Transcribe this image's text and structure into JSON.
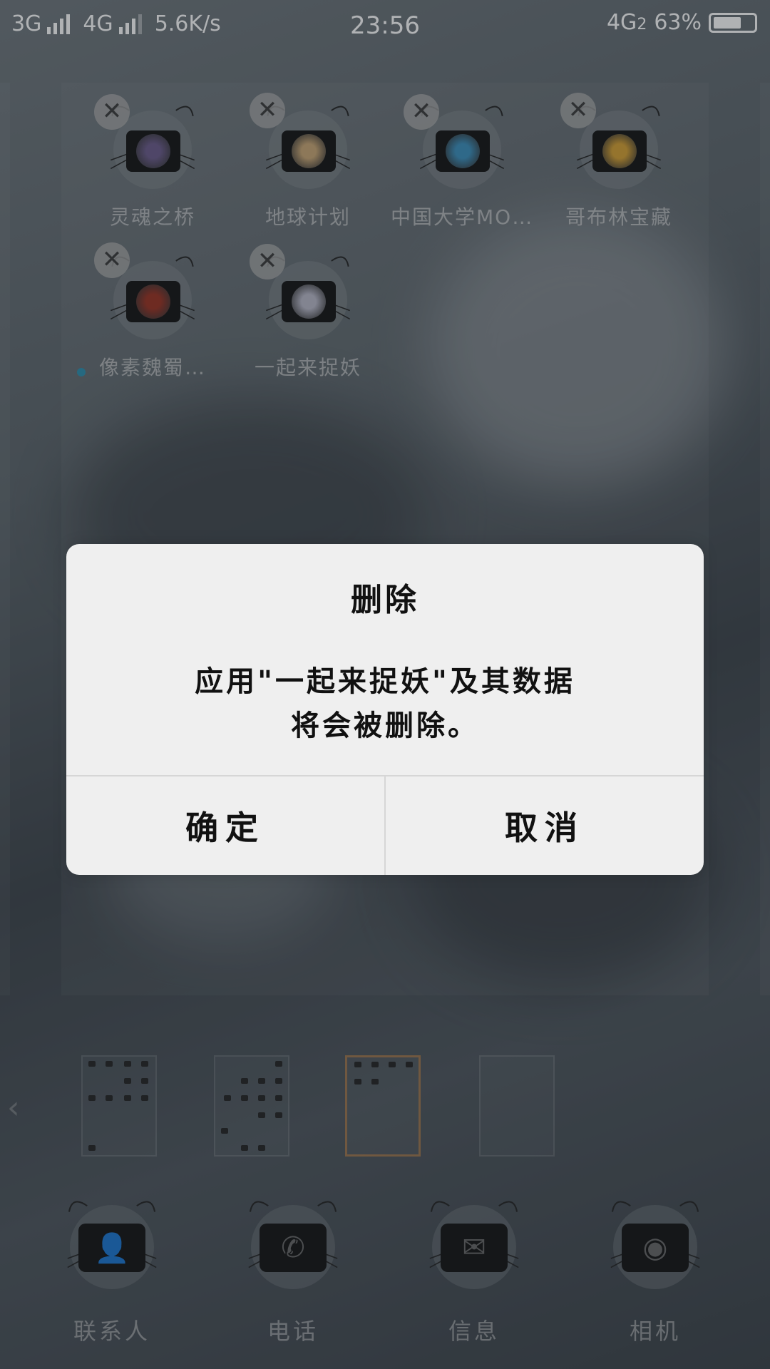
{
  "status_bar": {
    "network1": "3G",
    "network2": "4G",
    "speed": "5.6K/s",
    "time": "23:56",
    "network3": "4G",
    "sim_index": "2",
    "battery": "63%"
  },
  "folder_apps": [
    {
      "label": "灵魂之桥",
      "icon": "anime-girl-icon",
      "color": "#6a5a8a"
    },
    {
      "label": "地球计划",
      "icon": "anime-character-icon",
      "color": "#c9a673"
    },
    {
      "label": "中国大学MO…",
      "icon": "mooc-cube-icon",
      "color": "#3a8fbd"
    },
    {
      "label": "哥布林宝藏",
      "icon": "goblin-treasure-icon",
      "color": "#d6a030"
    },
    {
      "label": "像素魏蜀…",
      "icon": "pixel-warrior-icon",
      "color": "#9a3020"
    },
    {
      "label": "一起来捉妖",
      "icon": "monster-catch-icon",
      "color": "#b8b8c8"
    }
  ],
  "dock": [
    {
      "label": "联系人",
      "icon": "contacts-icon",
      "glyph": "👤"
    },
    {
      "label": "电话",
      "icon": "phone-icon",
      "glyph": "✆"
    },
    {
      "label": "信息",
      "icon": "message-icon",
      "glyph": "✉"
    },
    {
      "label": "相机",
      "icon": "camera-icon",
      "glyph": "◉"
    }
  ],
  "dialog": {
    "title": "删除",
    "message_line1": "应用\"一起来捉妖\"及其数据",
    "message_line2": "将会被删除。",
    "confirm": "确定",
    "cancel": "取消"
  },
  "close_glyph": "✕",
  "page_indicator": {
    "current_page": 3,
    "total_pages": 4
  }
}
